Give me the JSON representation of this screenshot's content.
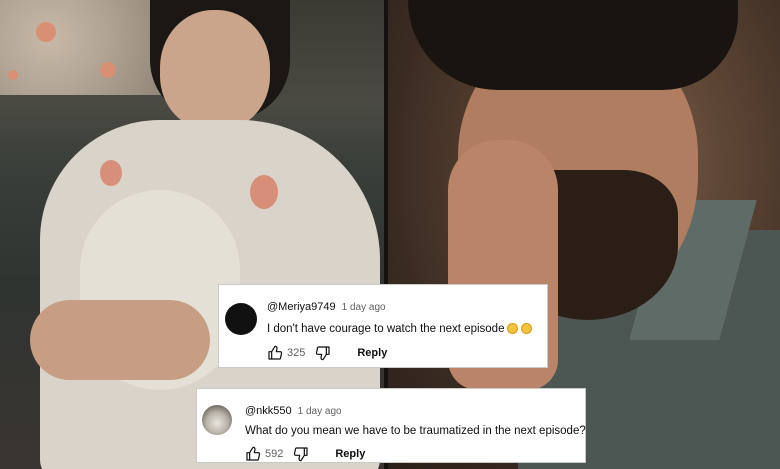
{
  "comments": [
    {
      "handle": "@Meriya9749",
      "time": "1 day ago",
      "text": "I don't have courage to watch the next episode",
      "emojis": [
        "slightly-smiling-face",
        "persevering-face"
      ],
      "likes": "325",
      "reply_label": "Reply",
      "avatar": "black-avatar"
    },
    {
      "handle": "@nkk550",
      "time": "1 day ago",
      "text": "What do you mean we have to be traumatized in the next episode?",
      "likes": "592",
      "reply_label": "Reply",
      "avatar": "photo-avatar"
    }
  ],
  "icons": {
    "like": "thumbs-up-icon",
    "dislike": "thumbs-down-icon"
  },
  "colors": {
    "card": "#ffffff",
    "text": "#0f0f0f",
    "meta": "#606060"
  }
}
